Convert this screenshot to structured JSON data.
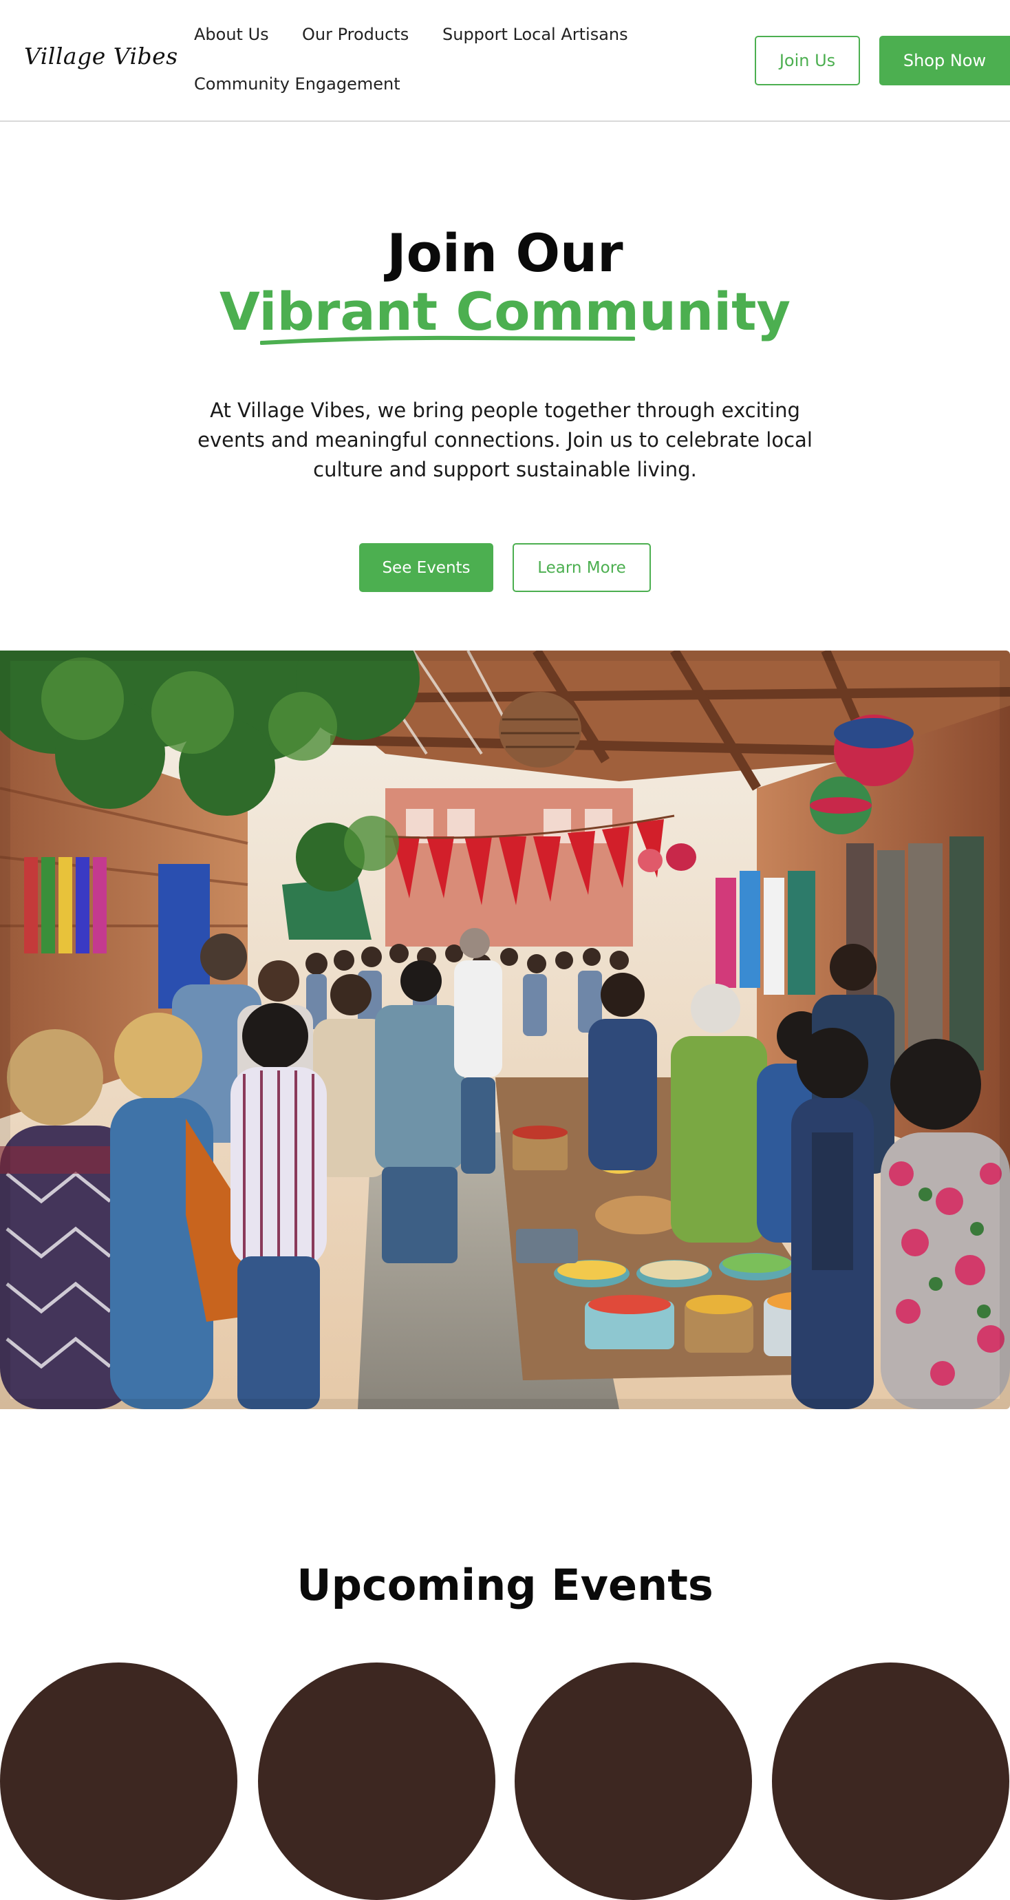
{
  "brand": {
    "logo_text": "Village Vibes"
  },
  "nav": {
    "links": [
      "About Us",
      "Our Products",
      "Support Local Artisans",
      "Community Engagement"
    ],
    "join_label": "Join Us",
    "shop_label": "Shop Now"
  },
  "hero": {
    "title_line1": "Join Our",
    "title_line2": "Vibrant Community",
    "description": "At Village Vibes, we bring people together through exciting events and meaningful connections. Join us to celebrate local culture and support sustainable living.",
    "primary_cta": "See Events",
    "secondary_cta": "Learn More"
  },
  "events": {
    "title": "Upcoming Events"
  },
  "colors": {
    "accent": "#4caf50",
    "text": "#111111",
    "event_card": "#3d2721",
    "divider": "#d9d9d9"
  },
  "icons": {
    "hero_underline": "brush-underline-icon"
  }
}
